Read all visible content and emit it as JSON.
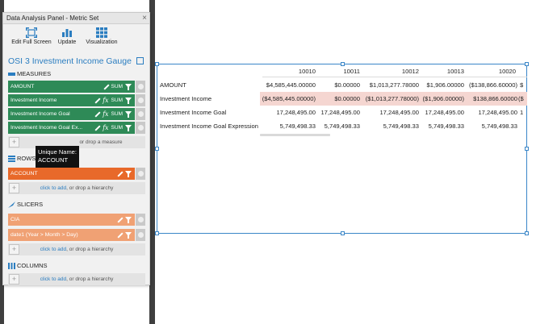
{
  "panel": {
    "title": "Data Analysis Panel - Metric Set",
    "close_glyph": "×",
    "toolbar": [
      {
        "label": "Edit Full Screen",
        "icon": "expand-icon"
      },
      {
        "label": "Update",
        "icon": "bar-chart-icon"
      },
      {
        "label": "Visualization",
        "icon": "grid-icon"
      }
    ],
    "metric_title": "OSI 3 Investment Income Gauge"
  },
  "measures": {
    "heading": "MEASURES",
    "items": [
      {
        "label": "AMOUNT",
        "agg": "SUM",
        "fx": false
      },
      {
        "label": "Investment Income",
        "agg": "SUM",
        "fx": true
      },
      {
        "label": "Investment Income Goal",
        "agg": "SUM",
        "fx": true
      },
      {
        "label": "Investment Income Goal Ex...",
        "agg": "SUM",
        "fx": true
      }
    ],
    "drop_text": "or drop a measure"
  },
  "rows": {
    "heading": "ROWS",
    "items": [
      {
        "label": "ACCOUNT"
      }
    ],
    "drop_link": "click to add",
    "drop_text": ", or drop a hierarchy"
  },
  "tooltip": {
    "line1": "Unique Name:",
    "line2": "ACCOUNT"
  },
  "slicers": {
    "heading": "SLICERS",
    "items": [
      {
        "label": "CIA"
      },
      {
        "label": "date1 (Year > Month > Day)"
      }
    ],
    "drop_link": "click to add",
    "drop_text": ", or drop a hierarchy"
  },
  "columns": {
    "heading": "COLUMNS",
    "drop_link": "click to add",
    "drop_text": ", or drop a hierarchy"
  },
  "grid": {
    "columns": [
      "10010",
      "10011",
      "10012",
      "10013",
      "10020",
      ""
    ],
    "rows": [
      {
        "label": "AMOUNT",
        "values": [
          "$4,585,445.00000",
          "$0.00000",
          "$1,013,277.78000",
          "$1,906.00000",
          "($138,866.60000)",
          "$"
        ]
      },
      {
        "label": "Investment Income",
        "values": [
          "($4,585,445.00000)",
          "$0.00000",
          "($1,013,277.78000)",
          "($1,906.00000)",
          "$138,866.60000",
          "($"
        ]
      },
      {
        "label": "Investment Income Goal",
        "values": [
          "17,248,495.00",
          "17,248,495.00",
          "17,248,495.00",
          "17,248,495.00",
          "17,248,495.00",
          "1"
        ]
      },
      {
        "label": "Investment Income Goal Expression",
        "values": [
          "5,749,498.33",
          "5,749,498.33",
          "5,749,498.33",
          "5,749,498.33",
          "5,749,498.33",
          ""
        ]
      }
    ]
  },
  "colors": {
    "accent": "#2a7dc0",
    "measure": "#2e8a57",
    "row": "#e8692a",
    "slicer": "#f0a174",
    "band": "#f5d6d1"
  }
}
